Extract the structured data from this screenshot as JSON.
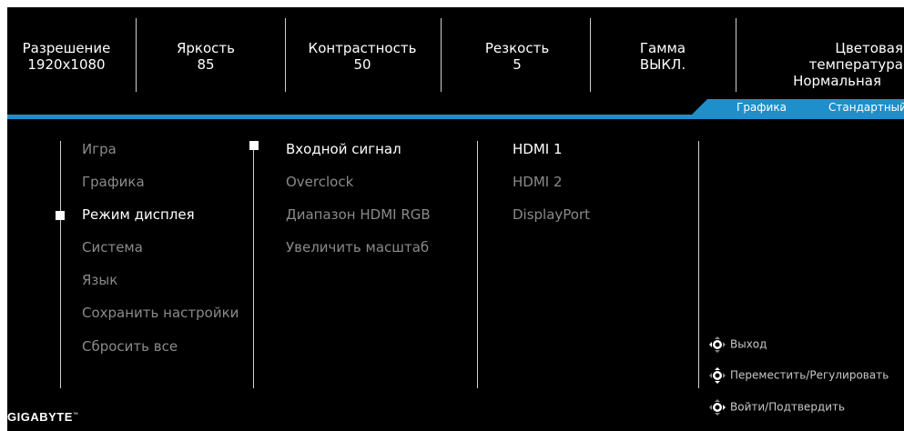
{
  "header": {
    "stats": [
      {
        "label": "Разрешение",
        "value": "1920x1080"
      },
      {
        "label": "Яркость",
        "value": "85"
      },
      {
        "label": "Контрастность",
        "value": "50"
      },
      {
        "label": "Резкость",
        "value": "5"
      },
      {
        "label": "Гамма",
        "value": "ВЫКЛ."
      },
      {
        "label": "Цветовая температура",
        "value": "Нормальная"
      }
    ]
  },
  "mode_tabs": [
    "Графика",
    "Стандартный"
  ],
  "main_menu": {
    "items": [
      "Игра",
      "Графика",
      "Режим дисплея",
      "Система",
      "Язык",
      "Сохранить настройки",
      "Сбросить все"
    ],
    "selected": "Режим дисплея"
  },
  "sub_menu": {
    "items": [
      "Входной сигнал",
      "Overclock",
      "Диапазон HDMI RGB",
      "Увеличить масштаб"
    ],
    "selected": "Входной сигнал"
  },
  "options": {
    "items": [
      "HDMI 1",
      "HDMI 2",
      "DisplayPort"
    ],
    "selected": "HDMI 1"
  },
  "hints": [
    {
      "icon": "joystick-left-icon",
      "label": "Выход"
    },
    {
      "icon": "joystick-move-icon",
      "label": "Переместить/Регулировать"
    },
    {
      "icon": "joystick-press-icon",
      "label": "Войти/Подтвердить"
    }
  ],
  "brand": {
    "name": "GIGABYTE",
    "mark": "™"
  },
  "colors": {
    "accent": "#1f8fcc",
    "background": "#000000",
    "dim_text": "#8a8a8a"
  }
}
